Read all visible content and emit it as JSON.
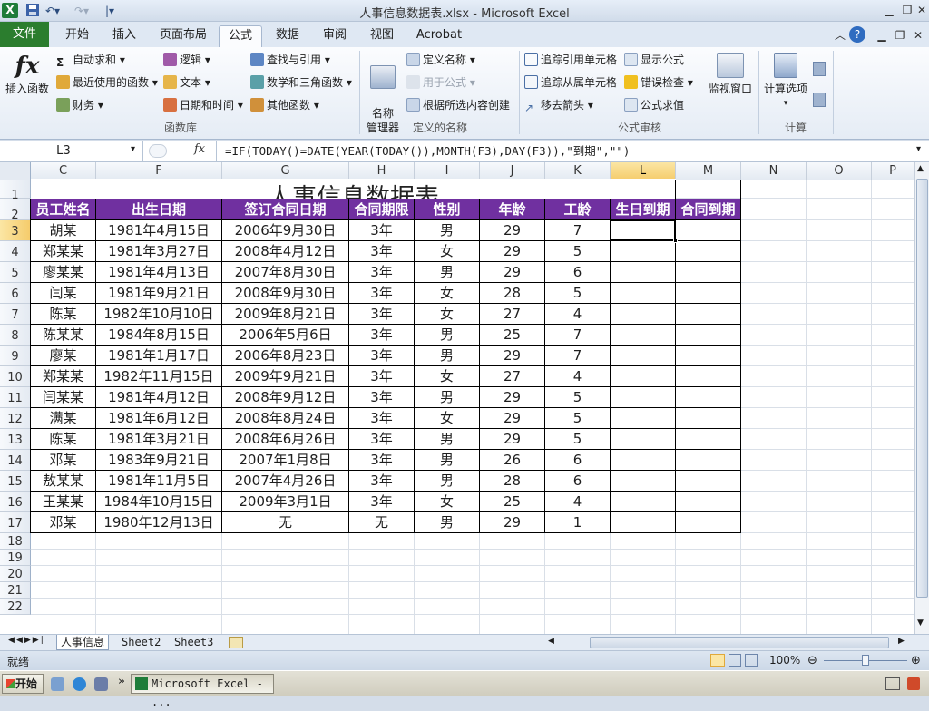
{
  "window": {
    "title": "人事信息数据表.xlsx - Microsoft Excel"
  },
  "qat": {
    "logo": "X",
    "save_icon": "save-icon",
    "undo_icon": "undo-icon",
    "redo_icon": "redo-icon"
  },
  "tabs": [
    "文件",
    "开始",
    "插入",
    "页面布局",
    "公式",
    "数据",
    "审阅",
    "视图",
    "Acrobat"
  ],
  "active_tab": "公式",
  "ribbon": {
    "insert_fn": {
      "glyph": "fx",
      "label": "插入函数"
    },
    "lib_items": [
      "自动求和",
      "最近使用的函数",
      "财务",
      "逻辑",
      "文本",
      "日期和时间",
      "查找与引用",
      "数学和三角函数",
      "其他函数"
    ],
    "lib_group": "函数库",
    "name_mgr": "名称\n管理器",
    "names_items": [
      "定义名称",
      "用于公式",
      "根据所选内容创建"
    ],
    "names_group": "定义的名称",
    "audit_items": [
      "追踪引用单元格",
      "追踪从属单元格",
      "移去箭头",
      "显示公式",
      "错误检查",
      "公式求值"
    ],
    "watch": "监视窗口",
    "audit_group": "公式审核",
    "calc_opts": "计算选项",
    "calc_group": "计算"
  },
  "formula_bar": {
    "name_box": "L3",
    "fx": "fx",
    "formula": "=IF(TODAY()=DATE(YEAR(TODAY()),MONTH(F3),DAY(F3)),\"到期\",\"\")"
  },
  "columns": [
    "C",
    "F",
    "G",
    "H",
    "I",
    "J",
    "K",
    "L",
    "M",
    "N",
    "O",
    "P"
  ],
  "selected_col": "L",
  "rows": [
    "1",
    "2",
    "3",
    "4",
    "5",
    "6",
    "7",
    "8",
    "9",
    "10",
    "11",
    "12",
    "13",
    "14",
    "15",
    "16",
    "17",
    "18",
    "19",
    "20",
    "21",
    "22"
  ],
  "selected_row": "3",
  "sheet": {
    "title": "人事信息数据表",
    "headers": [
      "员工姓名",
      "出生日期",
      "签订合同日期",
      "合同期限",
      "性别",
      "年龄",
      "工龄",
      "生日到期",
      "合同到期"
    ],
    "records": [
      [
        "胡某",
        "1981年4月15日",
        "2006年9月30日",
        "3年",
        "男",
        "29",
        "7"
      ],
      [
        "郑某某",
        "1981年3月27日",
        "2008年4月12日",
        "3年",
        "女",
        "29",
        "5"
      ],
      [
        "廖某某",
        "1981年4月13日",
        "2007年8月30日",
        "3年",
        "男",
        "29",
        "6"
      ],
      [
        "闫某",
        "1981年9月21日",
        "2008年9月30日",
        "3年",
        "女",
        "28",
        "5"
      ],
      [
        "陈某",
        "1982年10月10日",
        "2009年8月21日",
        "3年",
        "女",
        "27",
        "4"
      ],
      [
        "陈某某",
        "1984年8月15日",
        "2006年5月6日",
        "3年",
        "男",
        "25",
        "7"
      ],
      [
        "廖某",
        "1981年1月17日",
        "2006年8月23日",
        "3年",
        "男",
        "29",
        "7"
      ],
      [
        "郑某某",
        "1982年11月15日",
        "2009年9月21日",
        "3年",
        "女",
        "27",
        "4"
      ],
      [
        "闫某某",
        "1981年4月12日",
        "2008年9月12日",
        "3年",
        "男",
        "29",
        "5"
      ],
      [
        "满某",
        "1981年6月12日",
        "2008年8月24日",
        "3年",
        "女",
        "29",
        "5"
      ],
      [
        "陈某",
        "1981年3月21日",
        "2008年6月26日",
        "3年",
        "男",
        "29",
        "5"
      ],
      [
        "邓某",
        "1983年9月21日",
        "2007年1月8日",
        "3年",
        "男",
        "26",
        "6"
      ],
      [
        "敖某某",
        "1981年11月5日",
        "2007年4月26日",
        "3年",
        "男",
        "28",
        "6"
      ],
      [
        "王某某",
        "1984年10月15日",
        "2009年3月1日",
        "3年",
        "女",
        "25",
        "4"
      ],
      [
        "邓某",
        "1980年12月13日",
        "无",
        "无",
        "男",
        "29",
        "1"
      ]
    ]
  },
  "sheets": [
    "人事信息",
    "Sheet2",
    "Sheet3"
  ],
  "status": {
    "ready": "就绪",
    "zoom": "100%"
  },
  "taskbar": {
    "start": "开始",
    "app": "Microsoft Excel - ..."
  }
}
